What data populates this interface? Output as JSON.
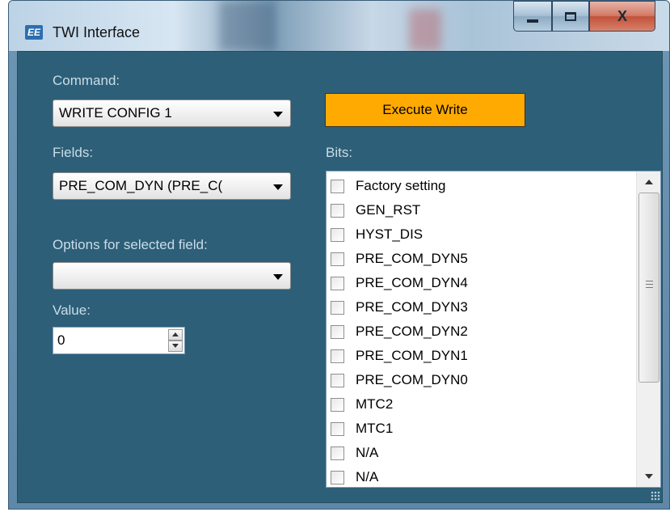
{
  "window": {
    "title": "TWI Interface",
    "app_icon": "EE",
    "controls": {
      "minimize": "minimize-icon",
      "maximize": "maximize-icon",
      "close": "X"
    }
  },
  "command": {
    "label": "Command:",
    "selected": "WRITE CONFIG 1"
  },
  "execute_button": {
    "label": "Execute Write",
    "color": "#ffaa00"
  },
  "fields": {
    "label": "Fields:",
    "selected": "PRE_COM_DYN (PRE_C("
  },
  "options": {
    "label": "Options for selected field:",
    "selected": ""
  },
  "value": {
    "label": "Value:",
    "current": "0"
  },
  "bits": {
    "label": "Bits:",
    "items": [
      "Factory setting",
      "GEN_RST",
      "HYST_DIS",
      "PRE_COM_DYN5",
      "PRE_COM_DYN4",
      "PRE_COM_DYN3",
      "PRE_COM_DYN2",
      "PRE_COM_DYN1",
      "PRE_COM_DYN0",
      "MTC2",
      "MTC1",
      "N/A",
      "N/A"
    ]
  }
}
